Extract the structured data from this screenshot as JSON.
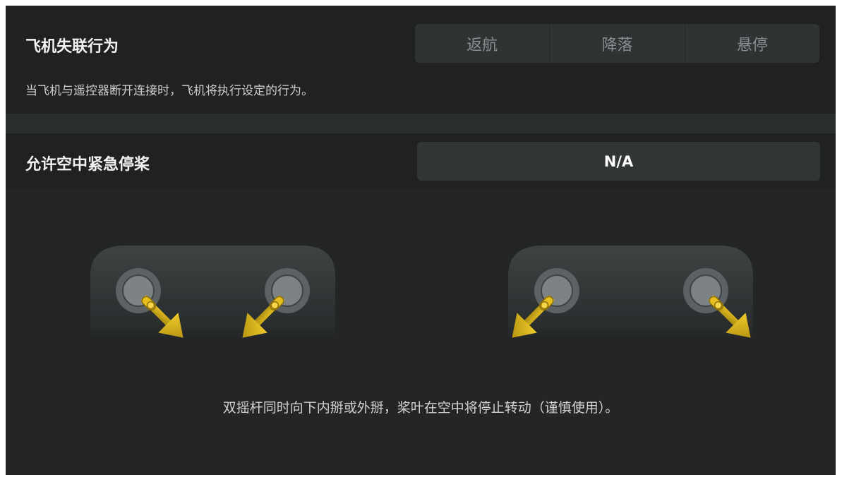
{
  "failsafe": {
    "title": "飞机失联行为",
    "description": "当飞机与遥控器断开连接时，飞机将执行设定的行为。",
    "options": [
      "返航",
      "降落",
      "悬停"
    ]
  },
  "emergency_stop": {
    "title": "允许空中紧急停桨",
    "value": "N/A",
    "instruction": "双摇杆同时向下内掰或外掰，桨叶在空中将停止转动（谨慎使用）。"
  },
  "colors": {
    "arrow": "#e0b616",
    "background": "#232526",
    "panel": "#1f2122"
  },
  "icons": [
    "controller-sticks-inward-icon",
    "controller-sticks-outward-icon"
  ]
}
